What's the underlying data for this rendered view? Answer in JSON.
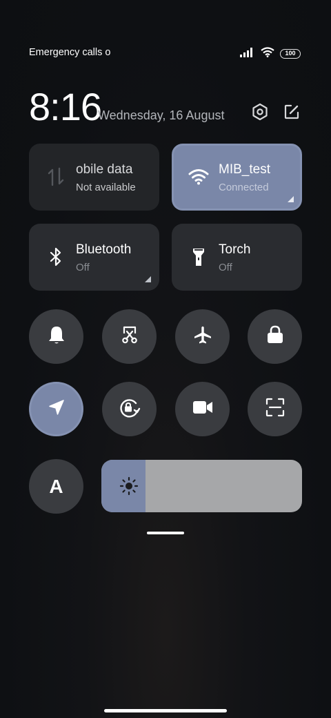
{
  "status_bar": {
    "carrier_text": "Emergency calls o",
    "battery": "100"
  },
  "header": {
    "time": "8:16",
    "date": "Wednesday, 16 August"
  },
  "tiles": {
    "mobile_data": {
      "title": "obile data",
      "subtitle": "Not available"
    },
    "wifi": {
      "title": "MIB_test",
      "subtitle": "Connected"
    },
    "bluetooth": {
      "title": "Bluetooth",
      "subtitle": "Off"
    },
    "torch": {
      "title": "Torch",
      "subtitle": "Off"
    }
  },
  "toggles": {
    "auto_brightness_letter": "A"
  },
  "brightness": {
    "level": 0.22
  },
  "colors": {
    "accent": "#7a87a8",
    "tile": "#2a2c30",
    "round": "#3a3c40",
    "slider_track": "#a6a7a9"
  },
  "icons": [
    "signal-icon",
    "wifi-icon",
    "battery-icon",
    "settings-icon",
    "edit-icon",
    "mobile-data-icon",
    "bluetooth-icon",
    "torch-icon",
    "bell-icon",
    "screenshot-icon",
    "airplane-icon",
    "lock-icon",
    "location-icon",
    "rotation-lock-icon",
    "video-icon",
    "scanner-icon",
    "brightness-icon"
  ]
}
